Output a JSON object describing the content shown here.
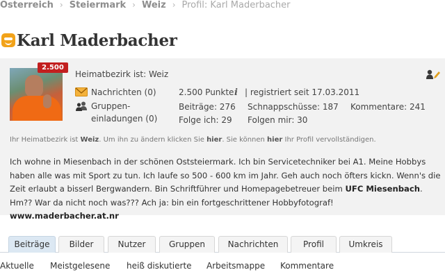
{
  "breadcrumb": [
    {
      "label": "Österreich"
    },
    {
      "label": "Steiermark"
    },
    {
      "label": "Weiz"
    },
    {
      "label": "Profil: Karl Maderbacher"
    }
  ],
  "breadcrumb_separator": "›",
  "page_title": "Karl Maderbacher",
  "profile": {
    "points_badge": "2.500",
    "district_line": "Heimatbezirk ist: Weiz",
    "messages": "Nachrichten (0)",
    "group_invites": "Gruppen-einladungen (0)",
    "points": "2.500 Punkte",
    "registered": "| registriert seit 17.03.2011",
    "info_symbol": "i",
    "posts": "Beiträge: 276",
    "snapshots": "Schnappschüsse: 187",
    "comments": "Kommentare: 241",
    "following": "Folge ich: 29",
    "followers": "Folgen mir: 30"
  },
  "notice": {
    "part1": "Ihr Heimatbezirk ist ",
    "district": "Weiz",
    "part2": ". Um ihn zu ändern klicken Sie ",
    "link1": "hier",
    "part3": ". Sie können ",
    "link2": "hier",
    "part4": " Ihr Profil vervollständigen."
  },
  "bio": {
    "text1": "Ich wohne in Miesenbach in der schönen Oststeiermark. Ich bin Servicetechniker bei A1. Meine Hobbys haben alle was mit Sport zu tun. Ich laufe so 500 - 600 km im Jahr. Geh auch noch öfters kickn. Wenn's die Zeit erlaubt a bisserl Bergwandern. Bin Schriftführer und Homepagebetreuer beim ",
    "club": "UFC Miesenbach",
    "text2": ". Hm?? War da nicht noch was??? Ach ja: bin ein fortgeschrittener Hobbyfotograf! ",
    "website": "www.maderbacher.at.nr"
  },
  "tabs": [
    "Beiträge",
    "Bilder",
    "Nutzer",
    "Gruppen",
    "Nachrichten",
    "Profil",
    "Umkreis"
  ],
  "subnav": [
    "Aktuelle",
    "Meistgelesene",
    "heiß diskutierte",
    "Arbeitsmappe",
    "Kommentare"
  ],
  "colors": {
    "badge_red": "#c21f1f",
    "logo_orange": "#f2a31a",
    "active_tab": "#dce8f3",
    "box_bg": "#f2f2f2"
  },
  "icons": {
    "logo": "meinbezirk-logo-icon",
    "edit": "user-edit-icon",
    "messages": "envelope-icon",
    "groups": "group-icon"
  }
}
